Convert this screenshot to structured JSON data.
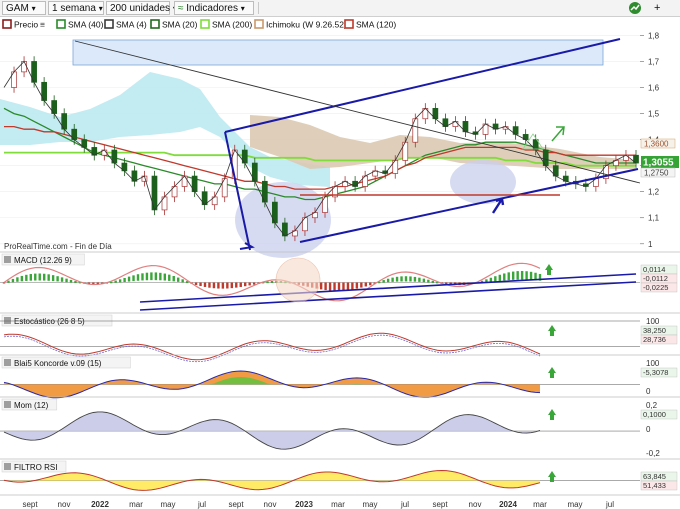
{
  "toolbar": {
    "symbol": "GAM",
    "timeframe": "1 semana",
    "units": "200 unidades",
    "indicators_label": "Indicadores",
    "add_icon": "plus-icon"
  },
  "main_legend": {
    "items": [
      {
        "label": "Precio",
        "color": "#8b1c1c"
      },
      {
        "label": "SMA (40)",
        "color": "#2a8a2a"
      },
      {
        "label": "SMA (4)",
        "color": "#3b3b3b"
      },
      {
        "label": "SMA (20)",
        "color": "#1f6b1f"
      },
      {
        "label": "SMA (200)",
        "color": "#7fdc3a"
      },
      {
        "label": "Ichimoku (W 9.26.52)",
        "color": "#c89a6a"
      },
      {
        "label": "SMA (120)",
        "color": "#c0392b"
      }
    ],
    "watermark": "ProRealTime.com - Fin de Día"
  },
  "chart_data": [
    {
      "type": "line",
      "panel": "price",
      "title": "",
      "y_ticks": [
        "1,8",
        "1,7",
        "1,6",
        "1,5",
        "1,4",
        "1,3",
        "1,2",
        "1,1",
        "1"
      ],
      "ylim": [
        0.98,
        1.84
      ],
      "x_ticks": [
        "sept",
        "nov",
        "2022",
        "mar",
        "may",
        "jul",
        "sept",
        "nov",
        "2023",
        "mar",
        "may",
        "jul",
        "sept",
        "nov",
        "2024",
        "mar",
        "may",
        "jul"
      ],
      "last_price": "1,3055",
      "price_labels": [
        "1,3600",
        "1,2750"
      ],
      "series": [
        {
          "name": "Precio",
          "values": [
            1.6,
            1.66,
            1.7,
            1.62,
            1.55,
            1.5,
            1.44,
            1.4,
            1.37,
            1.34,
            1.36,
            1.31,
            1.28,
            1.24,
            1.26,
            1.13,
            1.18,
            1.22,
            1.26,
            1.2,
            1.15,
            1.18,
            1.25,
            1.36,
            1.31,
            1.24,
            1.16,
            1.08,
            1.03,
            1.05,
            1.1,
            1.12,
            1.18,
            1.22,
            1.24,
            1.22,
            1.26,
            1.28,
            1.27,
            1.32,
            1.39,
            1.48,
            1.52,
            1.48,
            1.45,
            1.47,
            1.43,
            1.42,
            1.46,
            1.44,
            1.45,
            1.42,
            1.4,
            1.36,
            1.3,
            1.26,
            1.24,
            1.23,
            1.22,
            1.25,
            1.3,
            1.32,
            1.34,
            1.31
          ]
        },
        {
          "name": "SMA (40)",
          "values": [
            1.52,
            1.5,
            1.49,
            1.47,
            1.45,
            1.43,
            1.41,
            1.39,
            1.37,
            1.35,
            1.34,
            1.33,
            1.32,
            1.31,
            1.3,
            1.29,
            1.28,
            1.27,
            1.26,
            1.25,
            1.24,
            1.23,
            1.23,
            1.22,
            1.21,
            1.21,
            1.2,
            1.19,
            1.18,
            1.18,
            1.17,
            1.17,
            1.18,
            1.19,
            1.2,
            1.21,
            1.22,
            1.24,
            1.26,
            1.28,
            1.3,
            1.32,
            1.34,
            1.35,
            1.36,
            1.37,
            1.38,
            1.38,
            1.39,
            1.39,
            1.39,
            1.39,
            1.38,
            1.37,
            1.36,
            1.35,
            1.34,
            1.33,
            1.32,
            1.31,
            1.31,
            1.31,
            1.31,
            1.31
          ]
        },
        {
          "name": "SMA (200)",
          "values": [
            1.35,
            1.35,
            1.35,
            1.35,
            1.35,
            1.35,
            1.35,
            1.35,
            1.35,
            1.35,
            1.35,
            1.35,
            1.35,
            1.35,
            1.35,
            1.35,
            1.35,
            1.34,
            1.34,
            1.34,
            1.34,
            1.34,
            1.34,
            1.34,
            1.34,
            1.33,
            1.33,
            1.33,
            1.33,
            1.33,
            1.33,
            1.32,
            1.32,
            1.32,
            1.32,
            1.32,
            1.32,
            1.32,
            1.32,
            1.32,
            1.33,
            1.33,
            1.33,
            1.33,
            1.33,
            1.33,
            1.33,
            1.33,
            1.33,
            1.33,
            1.32,
            1.32,
            1.32,
            1.31,
            1.31,
            1.31,
            1.31,
            1.3,
            1.3,
            1.3,
            1.3,
            1.3,
            1.3,
            1.3
          ]
        },
        {
          "name": "SMA (120)",
          "values": [
            1.45,
            1.45,
            1.44,
            1.44,
            1.43,
            1.43,
            1.42,
            1.41,
            1.4,
            1.39,
            1.38,
            1.37,
            1.36,
            1.35,
            1.34,
            1.33,
            1.32,
            1.31,
            1.3,
            1.29,
            1.28,
            1.27,
            1.26,
            1.25,
            1.24,
            1.24,
            1.23,
            1.22,
            1.22,
            1.21,
            1.21,
            1.21,
            1.21,
            1.22,
            1.22,
            1.23,
            1.24,
            1.25,
            1.26,
            1.28,
            1.3,
            1.31,
            1.33,
            1.34,
            1.35,
            1.36,
            1.37,
            1.37,
            1.37,
            1.37,
            1.37,
            1.37,
            1.36,
            1.36,
            1.35,
            1.35,
            1.34,
            1.34,
            1.34,
            1.34,
            1.34,
            1.34,
            1.34,
            1.34
          ]
        }
      ]
    },
    {
      "type": "bar",
      "panel": "macd",
      "title": "MACD (12.26 9)",
      "value_labels": [
        "0,0114",
        "-0,0112",
        "-0,0225"
      ]
    },
    {
      "type": "line",
      "panel": "stochastic",
      "title": "Estocástico (26 8 5)",
      "y_ticks": [
        "100"
      ],
      "value_labels": [
        "38,250",
        "28,736"
      ]
    },
    {
      "type": "area",
      "panel": "koncorde",
      "title": "Blai5 Koncorde v.09 (15)",
      "y_ticks": [
        "100",
        "0"
      ],
      "value_labels": [
        "-5,3078"
      ]
    },
    {
      "type": "area",
      "panel": "momentum",
      "title": "Mom (12)",
      "y_ticks": [
        "0,2",
        "0",
        "-0,2"
      ],
      "value_labels": [
        "0,1000"
      ]
    },
    {
      "type": "area",
      "panel": "rsi",
      "title": "FILTRO RSI",
      "value_labels": [
        "63,845",
        "51,433"
      ]
    }
  ],
  "colors": {
    "down_candle": "#1c5e1c",
    "up_candle": "#a83232",
    "trend_line": "#1a1aa8",
    "cloud_fill": "#aee3ee",
    "cloud_fill_bear": "#d9c2a8",
    "highlight_box": "#dbe9fb",
    "arrow_green": "#3aa63a",
    "last_price_box": "#36a336"
  }
}
